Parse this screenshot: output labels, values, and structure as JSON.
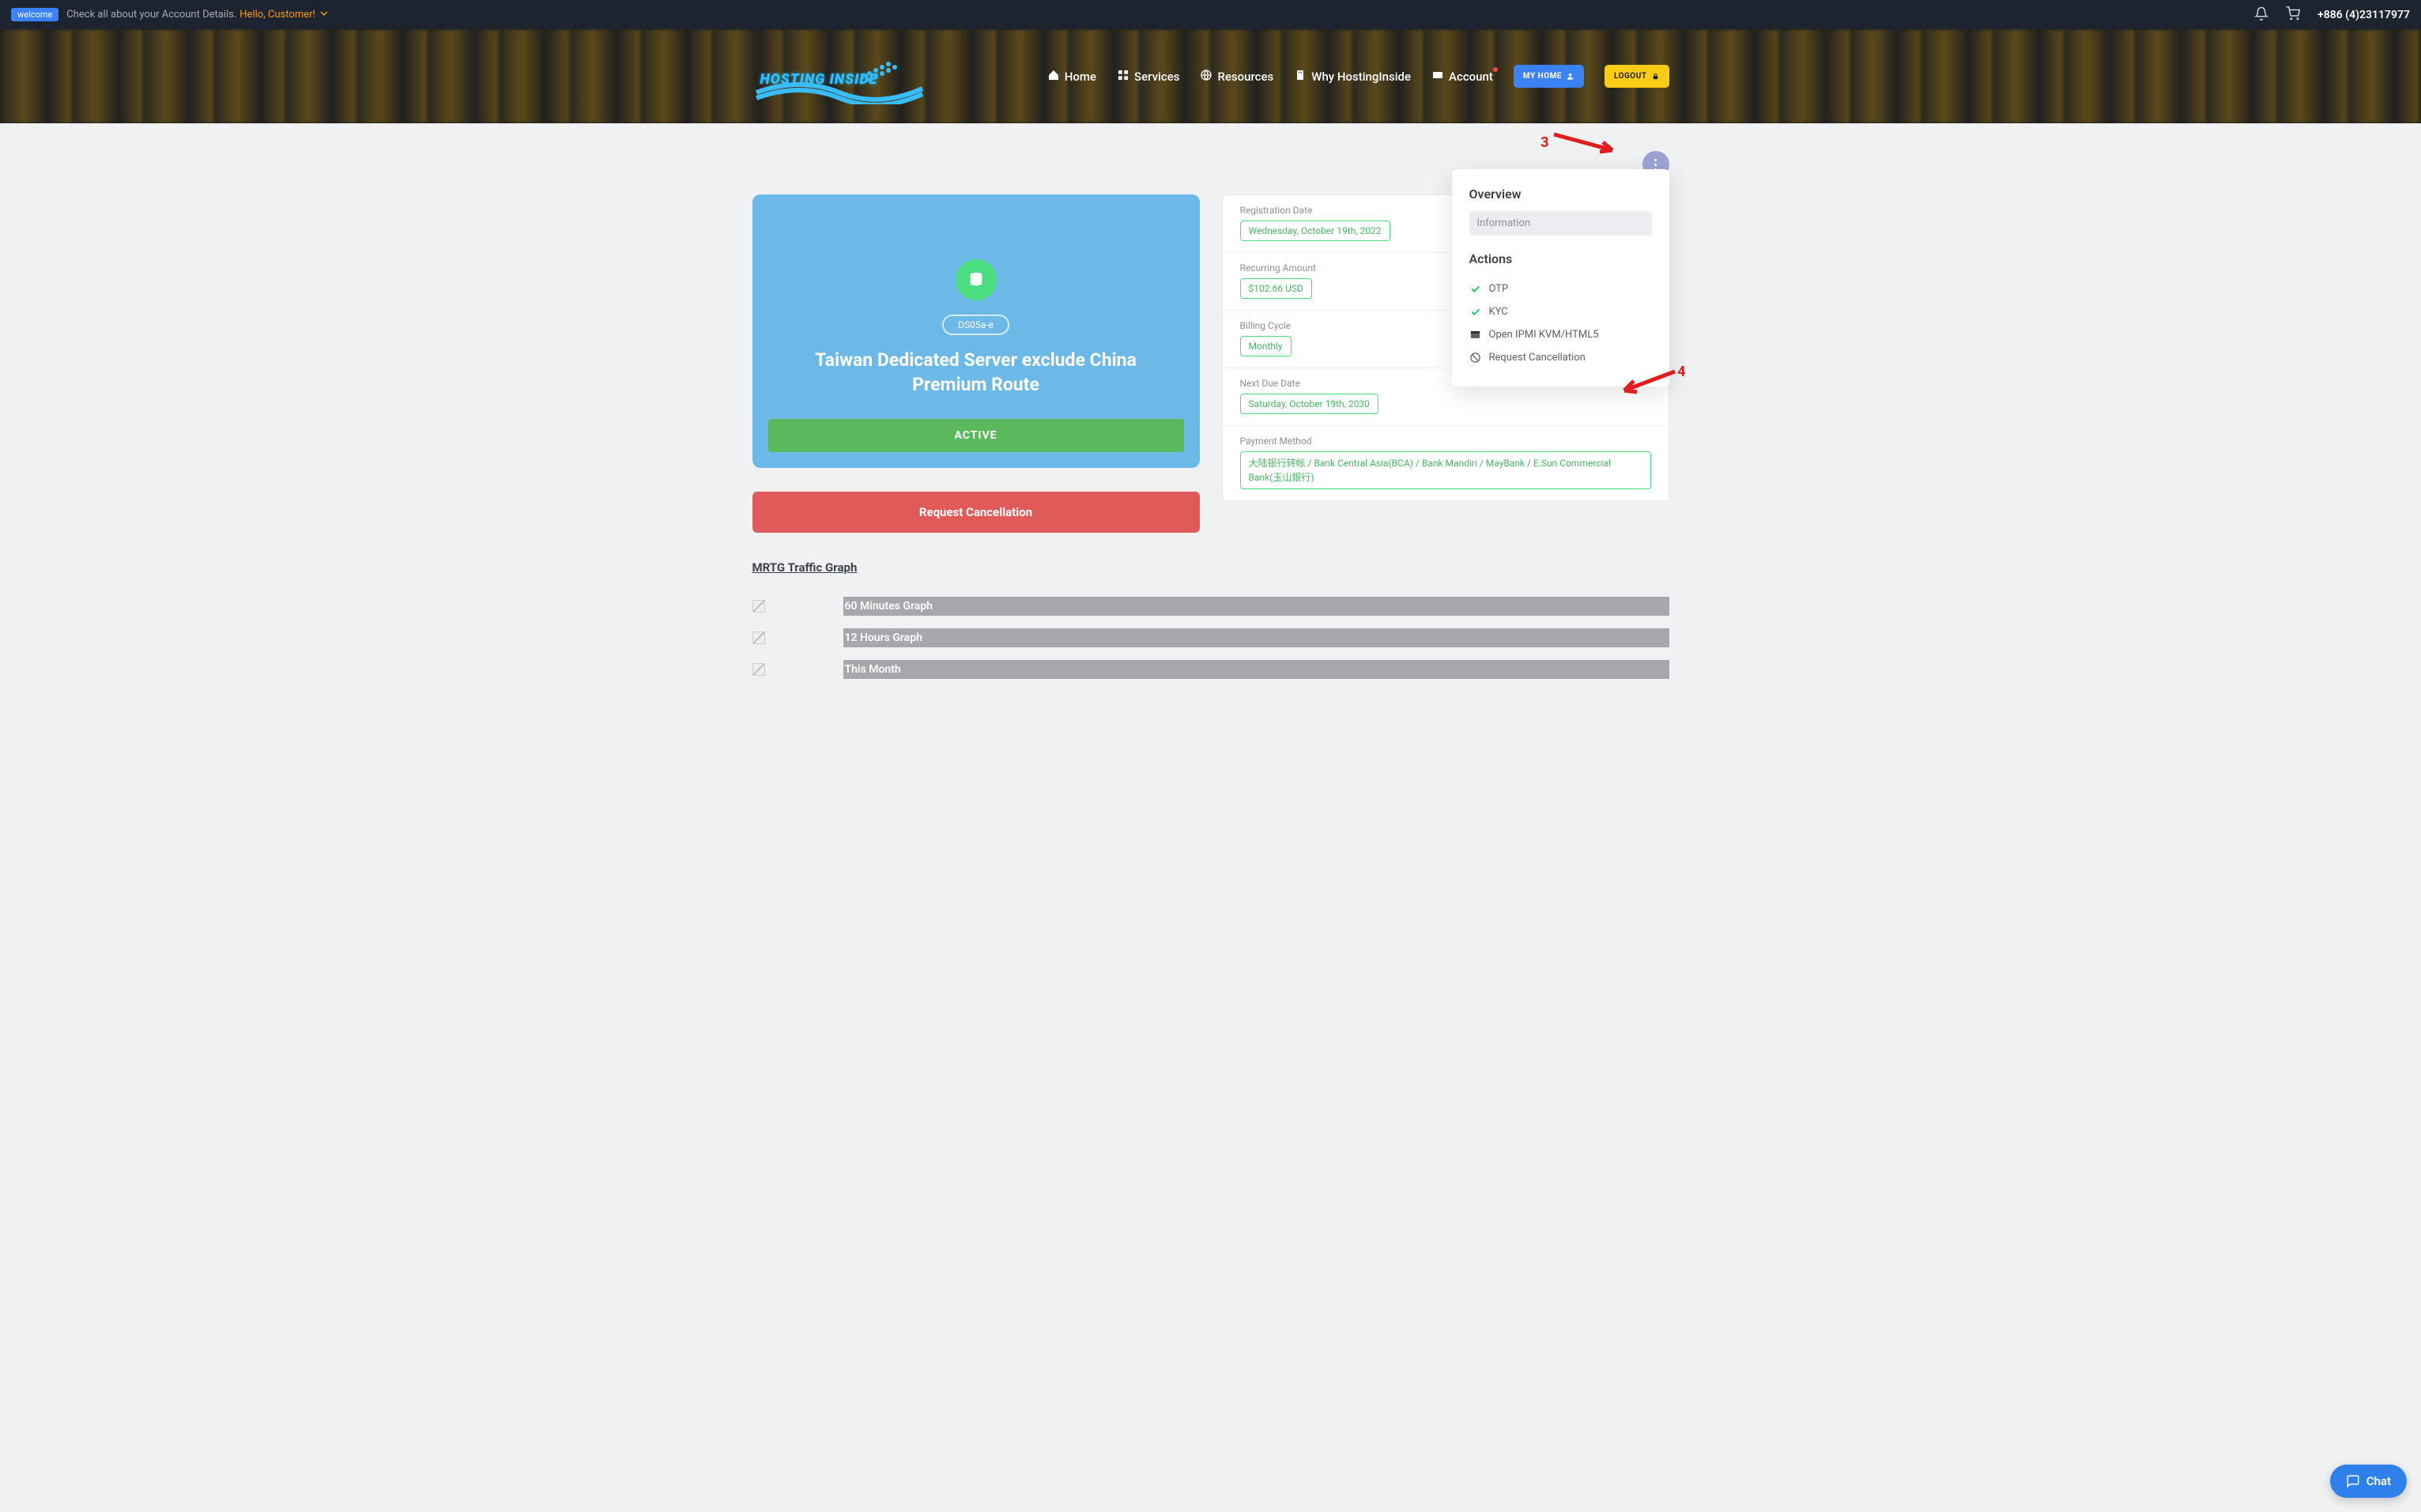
{
  "topbar": {
    "welcome_tag": "welcome",
    "account_text": "Check all about your Account Details.",
    "hello": "Hello, Customer!",
    "phone": "+886 (4)23117977"
  },
  "nav": {
    "home": "Home",
    "services": "Services",
    "resources": "Resources",
    "why": "Why HostingInside",
    "account": "Account",
    "my_home": "MY HOME",
    "logout": "LOGOUT"
  },
  "logo_text": "HOSTING INSIDE",
  "product": {
    "code": "DS05a-e",
    "title": "Taiwan Dedicated Server exclude China Premium Route",
    "status": "ACTIVE"
  },
  "info": {
    "registration_label": "Registration Date",
    "registration_value": "Wednesday, October 19th, 2022",
    "recurring_label": "Recurring Amount",
    "recurring_value": "$102.66 USD",
    "billing_label": "Billing Cycle",
    "billing_value": "Monthly",
    "due_label": "Next Due Date",
    "due_value": "Saturday, October 19th, 2030",
    "payment_label": "Payment Method",
    "payment_value": "大陆银行转帐 / Bank Central Asia(BCA) / Bank Mandiri / MayBank / E.Sun Commercial Bank(玉山銀行)"
  },
  "popover": {
    "overview": "Overview",
    "information": "Information",
    "actions": "Actions",
    "otp": "OTP",
    "kyc": "KYC",
    "ipmi": "Open IPMI KVM/HTML5",
    "cancel": "Request Cancellation"
  },
  "cancel_button": "Request Cancellation",
  "mrtg": {
    "title": "MRTG Traffic Graph",
    "g1": "60 Minutes Graph",
    "g2": "12 Hours Graph",
    "g3": "This Month"
  },
  "chat": "Chat",
  "annotations": {
    "a3": "3",
    "a4": "4"
  }
}
